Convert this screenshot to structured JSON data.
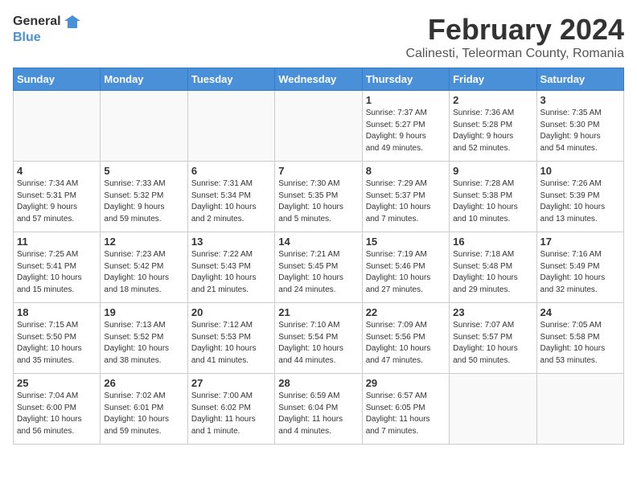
{
  "logo": {
    "line1": "General",
    "line2": "Blue"
  },
  "title": "February 2024",
  "subtitle": "Calinesti, Teleorman County, Romania",
  "days_header": [
    "Sunday",
    "Monday",
    "Tuesday",
    "Wednesday",
    "Thursday",
    "Friday",
    "Saturday"
  ],
  "weeks": [
    [
      {
        "day": "",
        "info": ""
      },
      {
        "day": "",
        "info": ""
      },
      {
        "day": "",
        "info": ""
      },
      {
        "day": "",
        "info": ""
      },
      {
        "day": "1",
        "info": "Sunrise: 7:37 AM\nSunset: 5:27 PM\nDaylight: 9 hours\nand 49 minutes."
      },
      {
        "day": "2",
        "info": "Sunrise: 7:36 AM\nSunset: 5:28 PM\nDaylight: 9 hours\nand 52 minutes."
      },
      {
        "day": "3",
        "info": "Sunrise: 7:35 AM\nSunset: 5:30 PM\nDaylight: 9 hours\nand 54 minutes."
      }
    ],
    [
      {
        "day": "4",
        "info": "Sunrise: 7:34 AM\nSunset: 5:31 PM\nDaylight: 9 hours\nand 57 minutes."
      },
      {
        "day": "5",
        "info": "Sunrise: 7:33 AM\nSunset: 5:32 PM\nDaylight: 9 hours\nand 59 minutes."
      },
      {
        "day": "6",
        "info": "Sunrise: 7:31 AM\nSunset: 5:34 PM\nDaylight: 10 hours\nand 2 minutes."
      },
      {
        "day": "7",
        "info": "Sunrise: 7:30 AM\nSunset: 5:35 PM\nDaylight: 10 hours\nand 5 minutes."
      },
      {
        "day": "8",
        "info": "Sunrise: 7:29 AM\nSunset: 5:37 PM\nDaylight: 10 hours\nand 7 minutes."
      },
      {
        "day": "9",
        "info": "Sunrise: 7:28 AM\nSunset: 5:38 PM\nDaylight: 10 hours\nand 10 minutes."
      },
      {
        "day": "10",
        "info": "Sunrise: 7:26 AM\nSunset: 5:39 PM\nDaylight: 10 hours\nand 13 minutes."
      }
    ],
    [
      {
        "day": "11",
        "info": "Sunrise: 7:25 AM\nSunset: 5:41 PM\nDaylight: 10 hours\nand 15 minutes."
      },
      {
        "day": "12",
        "info": "Sunrise: 7:23 AM\nSunset: 5:42 PM\nDaylight: 10 hours\nand 18 minutes."
      },
      {
        "day": "13",
        "info": "Sunrise: 7:22 AM\nSunset: 5:43 PM\nDaylight: 10 hours\nand 21 minutes."
      },
      {
        "day": "14",
        "info": "Sunrise: 7:21 AM\nSunset: 5:45 PM\nDaylight: 10 hours\nand 24 minutes."
      },
      {
        "day": "15",
        "info": "Sunrise: 7:19 AM\nSunset: 5:46 PM\nDaylight: 10 hours\nand 27 minutes."
      },
      {
        "day": "16",
        "info": "Sunrise: 7:18 AM\nSunset: 5:48 PM\nDaylight: 10 hours\nand 29 minutes."
      },
      {
        "day": "17",
        "info": "Sunrise: 7:16 AM\nSunset: 5:49 PM\nDaylight: 10 hours\nand 32 minutes."
      }
    ],
    [
      {
        "day": "18",
        "info": "Sunrise: 7:15 AM\nSunset: 5:50 PM\nDaylight: 10 hours\nand 35 minutes."
      },
      {
        "day": "19",
        "info": "Sunrise: 7:13 AM\nSunset: 5:52 PM\nDaylight: 10 hours\nand 38 minutes."
      },
      {
        "day": "20",
        "info": "Sunrise: 7:12 AM\nSunset: 5:53 PM\nDaylight: 10 hours\nand 41 minutes."
      },
      {
        "day": "21",
        "info": "Sunrise: 7:10 AM\nSunset: 5:54 PM\nDaylight: 10 hours\nand 44 minutes."
      },
      {
        "day": "22",
        "info": "Sunrise: 7:09 AM\nSunset: 5:56 PM\nDaylight: 10 hours\nand 47 minutes."
      },
      {
        "day": "23",
        "info": "Sunrise: 7:07 AM\nSunset: 5:57 PM\nDaylight: 10 hours\nand 50 minutes."
      },
      {
        "day": "24",
        "info": "Sunrise: 7:05 AM\nSunset: 5:58 PM\nDaylight: 10 hours\nand 53 minutes."
      }
    ],
    [
      {
        "day": "25",
        "info": "Sunrise: 7:04 AM\nSunset: 6:00 PM\nDaylight: 10 hours\nand 56 minutes."
      },
      {
        "day": "26",
        "info": "Sunrise: 7:02 AM\nSunset: 6:01 PM\nDaylight: 10 hours\nand 59 minutes."
      },
      {
        "day": "27",
        "info": "Sunrise: 7:00 AM\nSunset: 6:02 PM\nDaylight: 11 hours\nand 1 minute."
      },
      {
        "day": "28",
        "info": "Sunrise: 6:59 AM\nSunset: 6:04 PM\nDaylight: 11 hours\nand 4 minutes."
      },
      {
        "day": "29",
        "info": "Sunrise: 6:57 AM\nSunset: 6:05 PM\nDaylight: 11 hours\nand 7 minutes."
      },
      {
        "day": "",
        "info": ""
      },
      {
        "day": "",
        "info": ""
      }
    ]
  ]
}
